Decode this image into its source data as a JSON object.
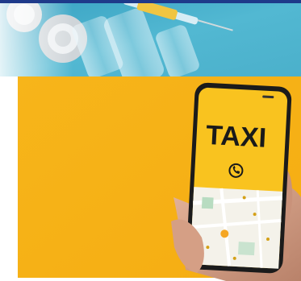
{
  "images": {
    "vials_photo": {
      "description_icon": "vials-syringe-photo"
    },
    "taxi_ad": {
      "app_title": "TAXI",
      "call_icon": "phone-icon",
      "background": "#f8b81c"
    }
  },
  "colors": {
    "top_bar": "#1e3a8a",
    "vials_bg": "#4fb3cf",
    "taxi_yellow": "#f8b81c"
  }
}
